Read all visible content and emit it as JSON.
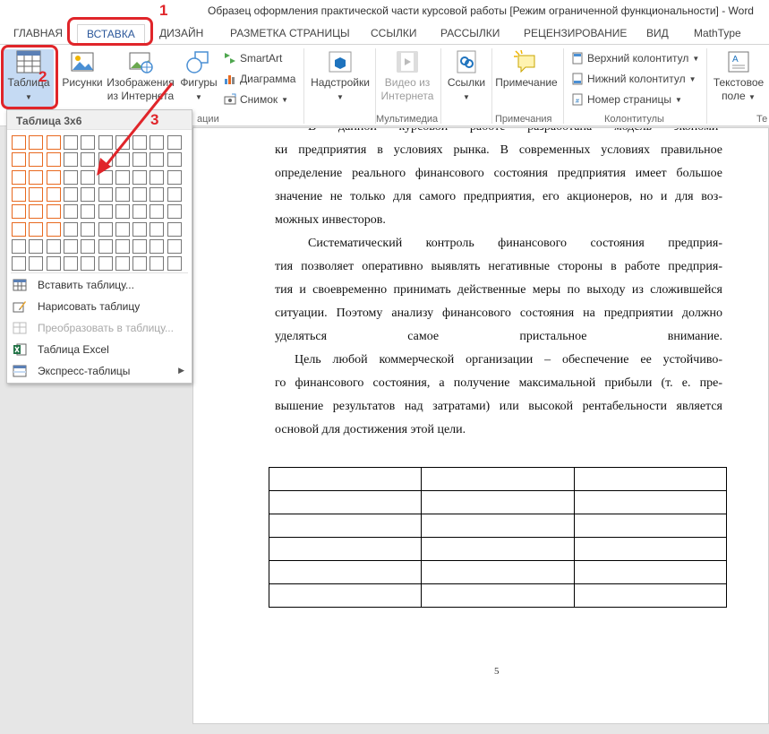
{
  "window": {
    "title": "Образец оформления практической части курсовой работы [Режим ограниченной функциональности] - Word"
  },
  "tabs": [
    "ГЛАВНАЯ",
    "ВСТАВКА",
    "ДИЗАЙН",
    "РАЗМЕТКА СТРАНИЦЫ",
    "ССЫЛКИ",
    "РАССЫЛКИ",
    "РЕЦЕНЗИРОВАНИЕ",
    "ВИД",
    "MathType"
  ],
  "ribbon": {
    "table": "Таблица",
    "pictures": "Рисунки",
    "online_pictures_l1": "Изображения",
    "online_pictures_l2": "из Интернета",
    "shapes": "Фигуры",
    "smartart": "SmartArt",
    "chart": "Диаграмма",
    "screenshot": "Снимок",
    "addins": "Надстройки",
    "video_l1": "Видео из",
    "video_l2": "Интернета",
    "links": "Ссылки",
    "comment": "Примечание",
    "header": "Верхний колонтитул",
    "footer": "Нижний колонтитул",
    "page_number": "Номер страницы",
    "textbox_l1": "Текстовое",
    "textbox_l2": "поле",
    "groups": {
      "illustrations_tail": "ации",
      "media": "Мультимедиа",
      "comments": "Примечания",
      "header_footer": "Колонтитулы",
      "text_tail": "Те"
    }
  },
  "table_menu": {
    "header": "Таблица 3x6",
    "grid_cols": 10,
    "grid_rows": 8,
    "selected_cols": 3,
    "selected_rows": 6,
    "items": [
      {
        "label": "Вставить таблицу...",
        "icon": "insert-table-icon",
        "disabled": false
      },
      {
        "label": "Нарисовать таблицу",
        "icon": "draw-table-icon",
        "disabled": false
      },
      {
        "label": "Преобразовать в таблицу...",
        "icon": "convert-table-icon",
        "disabled": true
      },
      {
        "label": "Таблица Excel",
        "icon": "excel-icon",
        "disabled": false
      },
      {
        "label": "Экспресс-таблицы",
        "icon": "quick-tables-icon",
        "disabled": false
      }
    ]
  },
  "document": {
    "lines": [
      "В   данной   курсовой   работе   разработана   модель   экономи-",
      "ки предприятия в    условиях   рынка.  В современных условиях   правильное",
      "определение реального  финансового состояния предприятия имеет большое",
      "значение не только для самого предприятия, его акционеров, но и для воз-",
      "можных   инвесторов.",
      "Систематический   контроль   финансового   состояния   предприя-",
      "тия позволяет оперативно  выявлять  негативные  стороны в работе  предприя-",
      "тия и своевременно принимать действенные меры по выходу из сложившейся",
      "ситуации. Поэтому анализу финансового состояния на предприятии должно",
      "уделяться               самое               пристальное               внимание.",
      "Цель   любой коммерческой  организации   – обеспечение ее   устойчиво-",
      "го  финансового состояния, а получение максимальной прибыли (т. е. пре-",
      "вышение результатов над затратами) или высокой рентабельности является",
      "основой для достижения этой цели."
    ],
    "table_rows": 6,
    "table_cols": 3,
    "page_number": "5"
  },
  "annotations": [
    "1",
    "2",
    "3"
  ],
  "colors": {
    "accent": "#2b579a",
    "annotation_red": "#e0252a",
    "grid_selection": "#e8691f"
  }
}
